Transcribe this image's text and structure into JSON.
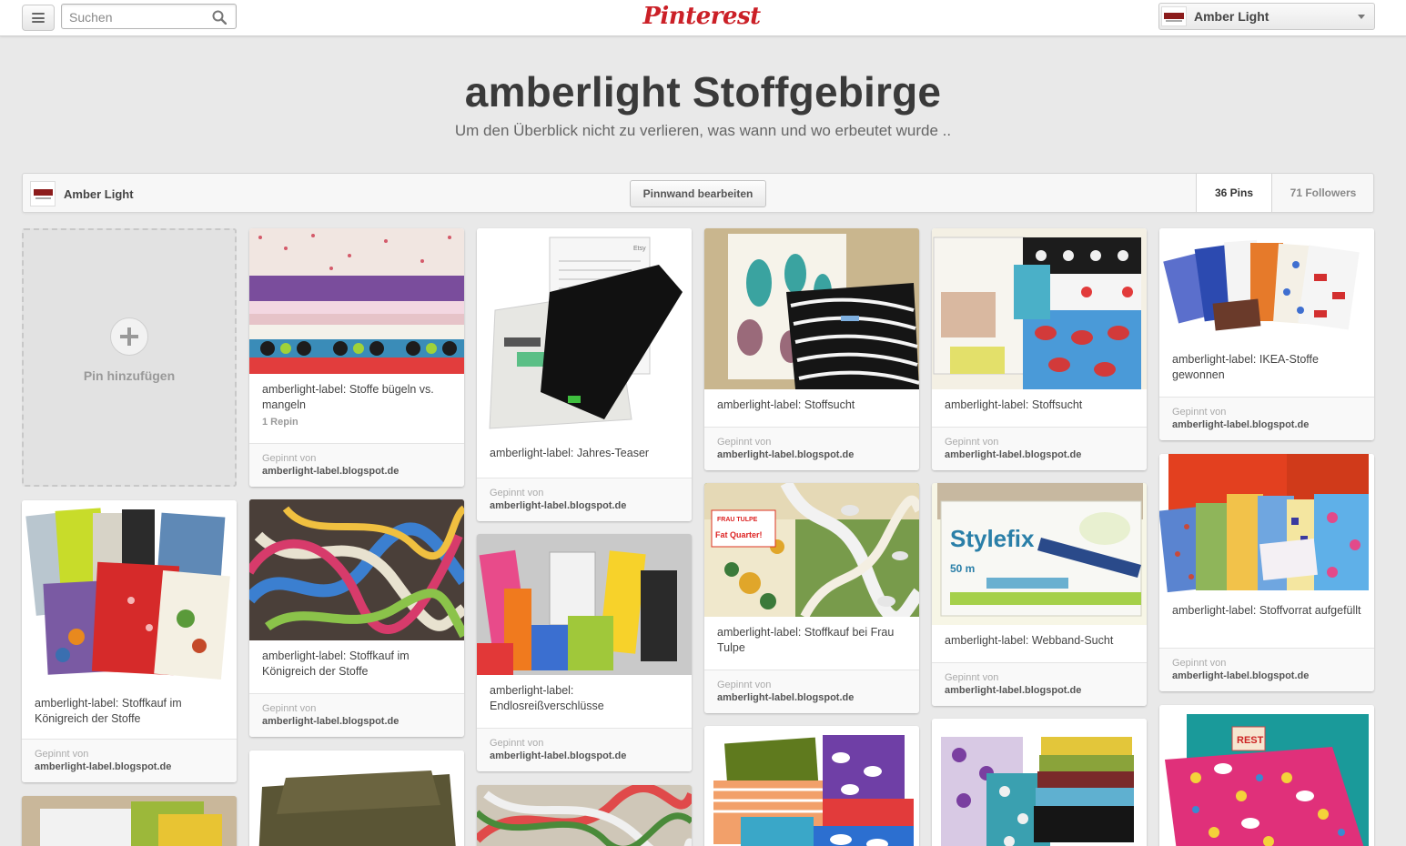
{
  "header": {
    "search_placeholder": "Suchen",
    "logo": "Pinterest",
    "user_name": "Amber Light"
  },
  "board": {
    "title": "amberlight Stoffgebirge",
    "description": "Um den Überblick nicht zu verlieren, was wann und wo erbeutet wurde ..",
    "owner": "Amber Light",
    "edit_label": "Pinnwand bearbeiten",
    "pins_count": "36 Pins",
    "followers_count": "71 Followers"
  },
  "add_pin_label": "Pin hinzufügen",
  "pins": [
    {
      "desc": "amberlight-label: Stoffe bügeln vs. mangeln",
      "repin": "1 Repin",
      "via": "Gepinnt von",
      "source": "amberlight-label.blogspot.de"
    },
    {
      "desc": "amberlight-label: Jahres-Teaser",
      "via": "Gepinnt von",
      "source": "amberlight-label.blogspot.de"
    },
    {
      "desc": "amberlight-label: Stoffsucht",
      "via": "Gepinnt von",
      "source": "amberlight-label.blogspot.de"
    },
    {
      "desc": "amberlight-label: Stoffsucht",
      "via": "Gepinnt von",
      "source": "amberlight-label.blogspot.de"
    },
    {
      "desc": "amberlight-label: IKEA-Stoffe gewonnen",
      "via": "Gepinnt von",
      "source": "amberlight-label.blogspot.de"
    },
    {
      "desc": "amberlight-label: Stoffkauf im Königreich der Stoffe",
      "via": "Gepinnt von",
      "source": "amberlight-label.blogspot.de"
    },
    {
      "desc": "amberlight-label: Stoffkauf im Königreich der Stoffe",
      "via": "Gepinnt von",
      "source": "amberlight-label.blogspot.de"
    },
    {
      "desc": "amberlight-label: Endlosreißverschlüsse",
      "via": "Gepinnt von",
      "source": "amberlight-label.blogspot.de"
    },
    {
      "desc": "amberlight-label: Stoffkauf bei Frau Tulpe",
      "via": "Gepinnt von",
      "source": "amberlight-label.blogspot.de"
    },
    {
      "desc": "amberlight-label: Webband-Sucht",
      "via": "Gepinnt von",
      "source": "amberlight-label.blogspot.de"
    },
    {
      "desc": "amberlight-label: Stoffvorrat aufgefüllt",
      "via": "Gepinnt von",
      "source": "amberlight-label.blogspot.de"
    }
  ],
  "image_text": {
    "fat_quarter_brand": "FRAU TULPE",
    "fat_quarter_label": "Fat Quarter!",
    "stylefix": "Stylefix",
    "stylefix_length": "50 m",
    "rest_tag": "REST",
    "etsy": "Etsy"
  }
}
